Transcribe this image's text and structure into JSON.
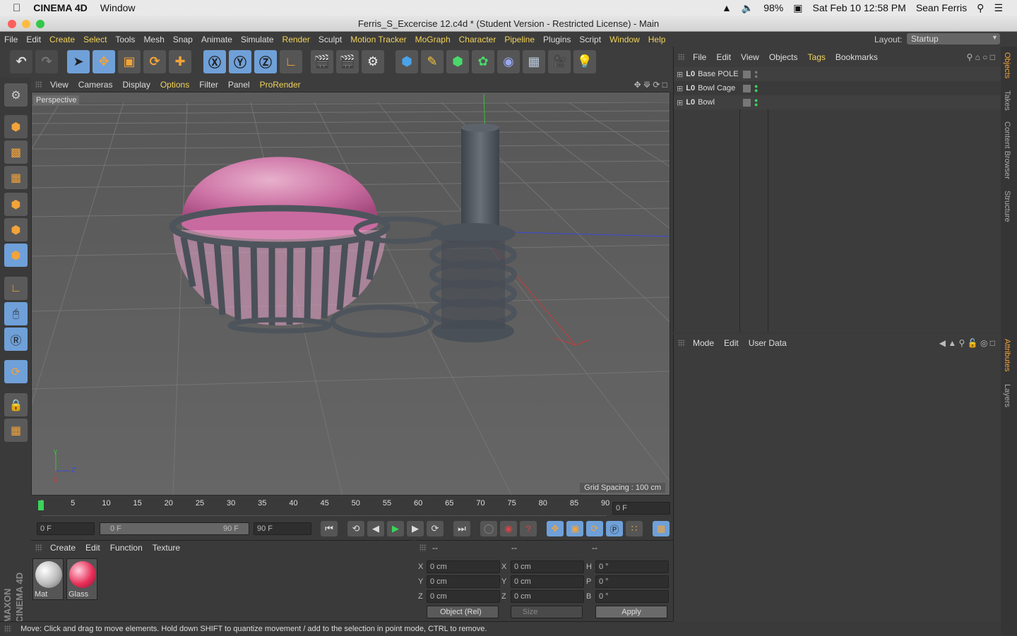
{
  "mac": {
    "app": "CINEMA 4D",
    "window_menu": "Window",
    "battery": "98%",
    "datetime": "Sat Feb 10  12:58 PM",
    "user": "Sean Ferris"
  },
  "window": {
    "title": "Ferris_S_Excercise 12.c4d * (Student Version - Restricted License) - Main"
  },
  "menubar": {
    "items": [
      {
        "label": "File",
        "hl": false
      },
      {
        "label": "Edit",
        "hl": false
      },
      {
        "label": "Create",
        "hl": true
      },
      {
        "label": "Select",
        "hl": true
      },
      {
        "label": "Tools",
        "hl": false
      },
      {
        "label": "Mesh",
        "hl": false
      },
      {
        "label": "Snap",
        "hl": false
      },
      {
        "label": "Animate",
        "hl": false
      },
      {
        "label": "Simulate",
        "hl": false
      },
      {
        "label": "Render",
        "hl": true
      },
      {
        "label": "Sculpt",
        "hl": false
      },
      {
        "label": "Motion Tracker",
        "hl": true
      },
      {
        "label": "MoGraph",
        "hl": true
      },
      {
        "label": "Character",
        "hl": true
      },
      {
        "label": "Pipeline",
        "hl": true
      },
      {
        "label": "Plugins",
        "hl": false
      },
      {
        "label": "Script",
        "hl": false
      },
      {
        "label": "Window",
        "hl": true
      },
      {
        "label": "Help",
        "hl": true
      }
    ],
    "layout_label": "Layout:",
    "layout_value": "Startup"
  },
  "viewport": {
    "menu": [
      {
        "label": "View",
        "hl": false
      },
      {
        "label": "Cameras",
        "hl": false
      },
      {
        "label": "Display",
        "hl": false
      },
      {
        "label": "Options",
        "hl": true
      },
      {
        "label": "Filter",
        "hl": false
      },
      {
        "label": "Panel",
        "hl": false
      },
      {
        "label": "ProRender",
        "hl": true
      }
    ],
    "camera_label": "Perspective",
    "grid_spacing": "Grid Spacing : 100 cm",
    "axis_y": "Y",
    "axis_z": "Z",
    "axis_x": "X"
  },
  "timeline": {
    "ticks": [
      "0",
      "5",
      "10",
      "15",
      "20",
      "25",
      "30",
      "35",
      "40",
      "45",
      "50",
      "55",
      "60",
      "65",
      "70",
      "75",
      "80",
      "85",
      "90"
    ],
    "current_frame": "0 F"
  },
  "playback": {
    "start": "0 F",
    "range_start": "0 F",
    "range_end": "90 F",
    "end": "90 F"
  },
  "material_manager": {
    "menu": [
      {
        "label": "Create",
        "hl": false
      },
      {
        "label": "Edit",
        "hl": false
      },
      {
        "label": "Function",
        "hl": false
      },
      {
        "label": "Texture",
        "hl": false
      }
    ],
    "materials": [
      {
        "name": "Mat",
        "color": "#e8e8e8"
      },
      {
        "name": "Glass",
        "color": "#e8305a"
      }
    ]
  },
  "coordinates": {
    "headers": [
      "--",
      "--",
      "--"
    ],
    "rows": [
      {
        "a": "X",
        "av": "0 cm",
        "b": "X",
        "bv": "0 cm",
        "c": "H",
        "cv": "0 °"
      },
      {
        "a": "Y",
        "av": "0 cm",
        "b": "Y",
        "bv": "0 cm",
        "c": "P",
        "cv": "0 °"
      },
      {
        "a": "Z",
        "av": "0 cm",
        "b": "Z",
        "bv": "0 cm",
        "c": "B",
        "cv": "0 °"
      }
    ],
    "mode": "Object (Rel)",
    "size": "Size",
    "apply": "Apply"
  },
  "object_manager": {
    "menu": [
      {
        "label": "File",
        "hl": false
      },
      {
        "label": "Edit",
        "hl": false
      },
      {
        "label": "View",
        "hl": false
      },
      {
        "label": "Objects",
        "hl": false
      },
      {
        "label": "Tags",
        "hl": true
      },
      {
        "label": "Bookmarks",
        "hl": false
      }
    ],
    "objects": [
      {
        "name": "Base POLE"
      },
      {
        "name": "Bowl Cage"
      },
      {
        "name": "Bowl"
      }
    ]
  },
  "attributes": {
    "menu": [
      {
        "label": "Mode",
        "hl": false
      },
      {
        "label": "Edit",
        "hl": false
      },
      {
        "label": "User Data",
        "hl": false
      }
    ]
  },
  "right_tabs": {
    "top": [
      "Objects",
      "Takes",
      "Content Browser",
      "Structure"
    ],
    "bottom": [
      "Attributes",
      "Layers"
    ]
  },
  "brand": "MAXON CINEMA 4D",
  "status": "Move: Click and drag to move elements. Hold down SHIFT to quantize movement / add to the selection in point mode, CTRL to remove.",
  "colors": {
    "accent_yellow": "#f2d35a",
    "accent_orange": "#f2a33a",
    "bowl_pink": "#e68cbd",
    "metal": "#5a5f66"
  }
}
